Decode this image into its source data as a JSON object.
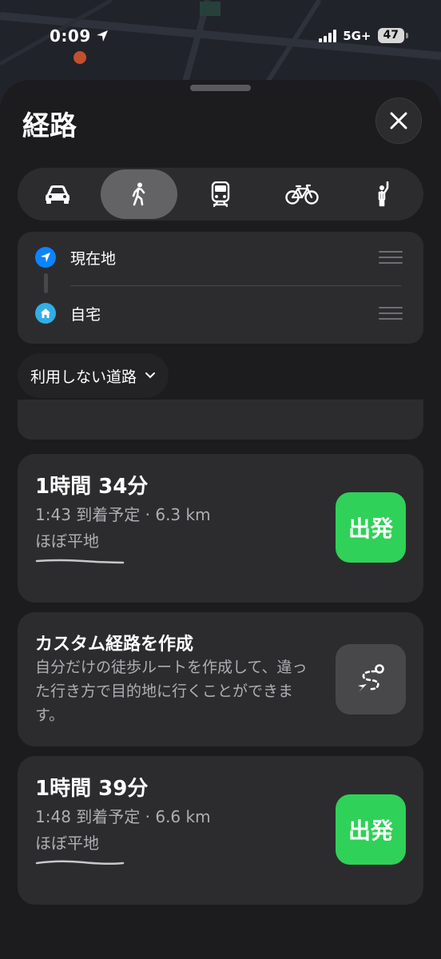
{
  "status_bar": {
    "time": "0:09",
    "network": "5G+",
    "battery": "47"
  },
  "sheet": {
    "title": "経路"
  },
  "transport_modes": [
    {
      "name": "car",
      "icon": "car-icon",
      "selected": false
    },
    {
      "name": "walk",
      "icon": "walking-icon",
      "selected": true
    },
    {
      "name": "transit",
      "icon": "train-icon",
      "selected": false
    },
    {
      "name": "cycle",
      "icon": "bicycle-icon",
      "selected": false
    },
    {
      "name": "ride",
      "icon": "hail-icon",
      "selected": false
    }
  ],
  "locations": {
    "origin": {
      "label": "現在地",
      "icon": "location-arrow-icon"
    },
    "destination": {
      "label": "自宅",
      "icon": "home-icon"
    }
  },
  "avoid": {
    "label": "利用しない道路"
  },
  "routes": [
    {
      "duration": "1時間 34分",
      "arrival": "1:43 到着予定 · 6.3 km",
      "terrain": "ほぼ平地",
      "go_label": "出発"
    },
    {
      "duration": "1時間 39分",
      "arrival": "1:48 到着予定 · 6.6 km",
      "terrain": "ほぼ平地",
      "go_label": "出発"
    }
  ],
  "custom_route": {
    "title": "カスタム経路を作成",
    "description": "自分だけの徒歩ルートを作成して、違った行き方で目的地に行くことができます。"
  },
  "colors": {
    "accent_blue": "#0a84ff",
    "go_green": "#30d158",
    "home_teal": "#32ade6"
  }
}
